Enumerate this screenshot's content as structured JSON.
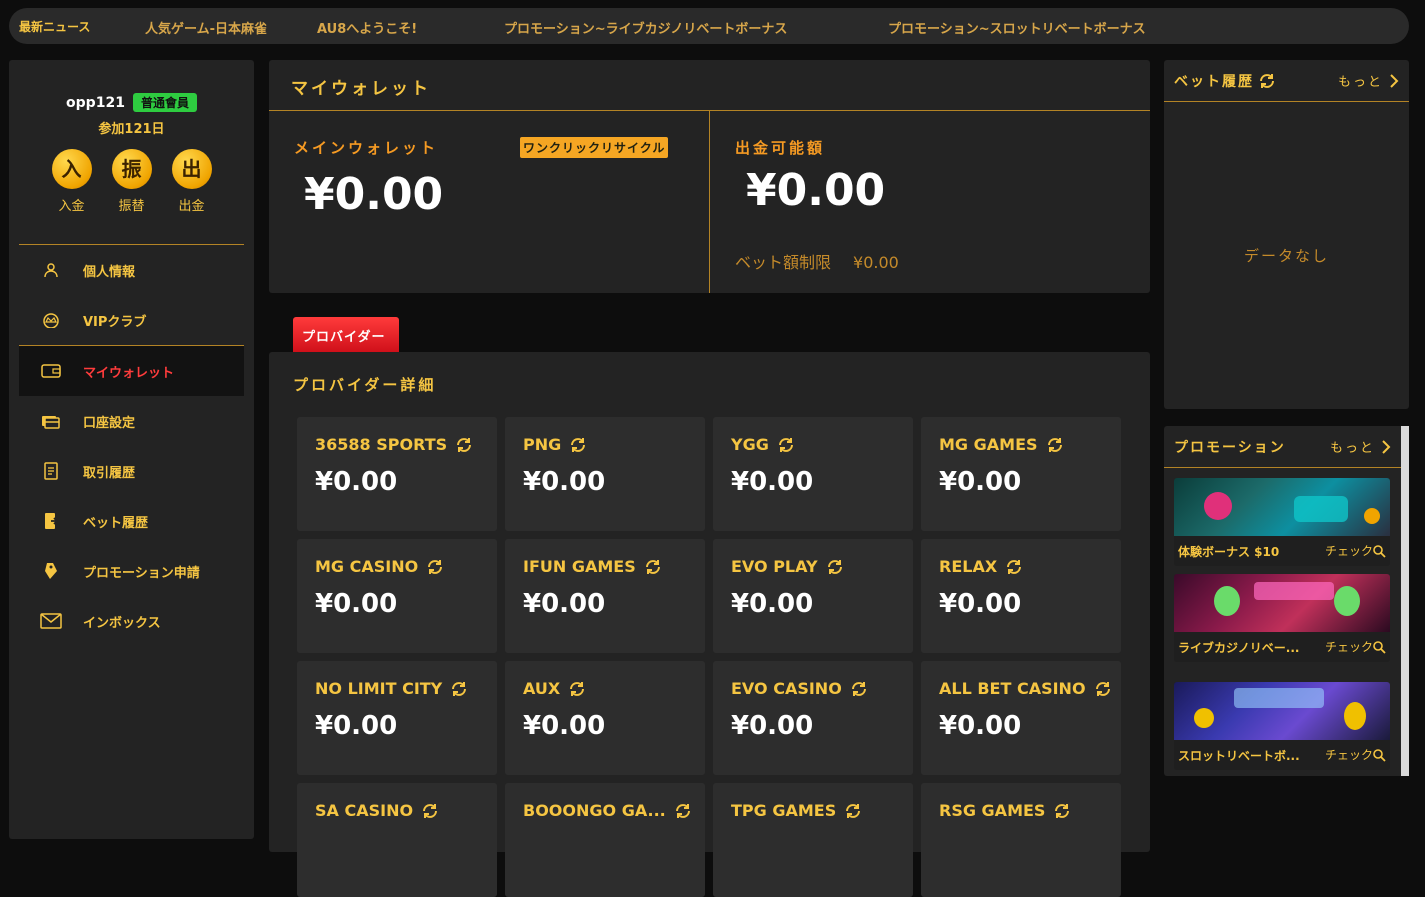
{
  "ticker": {
    "label": "最新ニュース",
    "messages": [
      "人気ゲーム-日本麻雀",
      "AU8へようこそ!",
      "プロモーション~ライブカジノリベートボーナス",
      "プロモーション~スロットリベートボーナス"
    ]
  },
  "profile": {
    "username": "opp121",
    "level": "普通會員",
    "joined": "参加121日",
    "actions": [
      {
        "glyph": "入",
        "label": "入金"
      },
      {
        "glyph": "振",
        "label": "振替"
      },
      {
        "glyph": "出",
        "label": "出金"
      }
    ]
  },
  "menu": [
    {
      "label": "個人情報",
      "icon": "user-icon"
    },
    {
      "label": "VIPクラブ",
      "icon": "crown-icon"
    },
    {
      "label": "マイウォレット",
      "icon": "wallet-icon",
      "active": true
    },
    {
      "label": "口座設定",
      "icon": "cards-icon"
    },
    {
      "label": "取引履歴",
      "icon": "document-icon"
    },
    {
      "label": "ベット履歴",
      "icon": "bet-icon"
    },
    {
      "label": "プロモーション申請",
      "icon": "tag-icon"
    },
    {
      "label": "インボックス",
      "icon": "mail-icon"
    }
  ],
  "wallet": {
    "title": "マイウォレット",
    "main_label": "メインウォレット",
    "main_amount": "¥0.00",
    "recycle_label": "ワンクリックリサイクル",
    "withdraw_label": "出金可能額",
    "withdraw_amount": "¥0.00",
    "bet_limit_label": "ベット額制限",
    "bet_limit_value": "¥0.00"
  },
  "provider_tab": "プロバイダー",
  "providers": {
    "title": "プロバイダー詳細",
    "items": [
      {
        "name": "36588 SPORTS",
        "amount": "¥0.00"
      },
      {
        "name": "PNG",
        "amount": "¥0.00"
      },
      {
        "name": "YGG",
        "amount": "¥0.00"
      },
      {
        "name": "MG GAMES",
        "amount": "¥0.00"
      },
      {
        "name": "MG CASINO",
        "amount": "¥0.00"
      },
      {
        "name": "IFUN GAMES",
        "amount": "¥0.00"
      },
      {
        "name": "EVO PLAY",
        "amount": "¥0.00"
      },
      {
        "name": "RELAX",
        "amount": "¥0.00"
      },
      {
        "name": "NO LIMIT CITY",
        "amount": "¥0.00"
      },
      {
        "name": "AUX",
        "amount": "¥0.00"
      },
      {
        "name": "EVO CASINO",
        "amount": "¥0.00"
      },
      {
        "name": "ALL BET CASINO",
        "amount": "¥0.00"
      },
      {
        "name": "SA CASINO",
        "amount": ""
      },
      {
        "name": "BOOONGO GA...",
        "amount": ""
      },
      {
        "name": "TPG GAMES",
        "amount": ""
      },
      {
        "name": "RSG GAMES",
        "amount": ""
      }
    ]
  },
  "bet_history": {
    "title": "ベット履歴",
    "more": "もっと",
    "empty": "データなし"
  },
  "promotions": {
    "title": "プロモーション",
    "more": "もっと",
    "items": [
      {
        "caption": "体験ボーナス $10",
        "check": "チェック"
      },
      {
        "caption": "ライブカジノリベー...",
        "check": "チェック"
      },
      {
        "caption": "スロットリベートボ...",
        "check": "チェック"
      }
    ]
  },
  "colors": {
    "accent": "#f5c542",
    "tab_red": "#e8161e",
    "panel": "#232323"
  }
}
